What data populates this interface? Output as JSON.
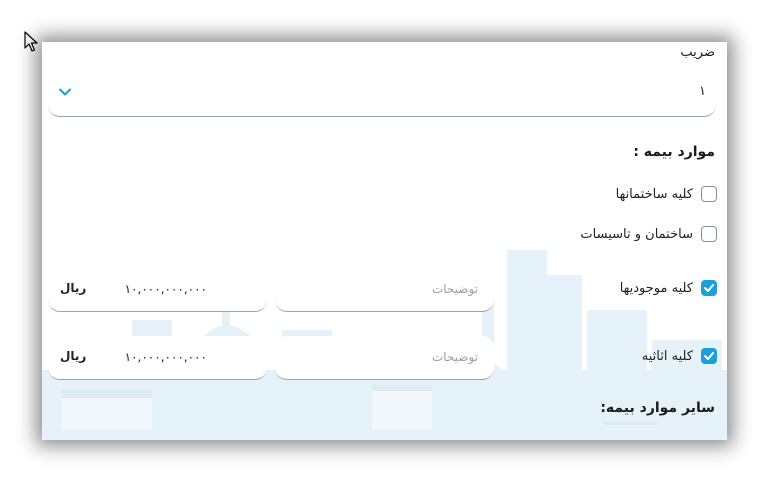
{
  "form": {
    "coefficient_label": "ضریب",
    "coefficient_value": "۱",
    "insurance_items_title": "موارد بیمه :",
    "other_items_title": "سایر موارد بیمه:"
  },
  "items": [
    {
      "label": "کلیه ساختمانها",
      "checked": false
    },
    {
      "label": "ساختمان و تاسیسات",
      "checked": false
    },
    {
      "label": "کلیه موجودیها",
      "checked": true,
      "description_placeholder": "توضیحات",
      "amount": "۱۰,۰۰۰,۰۰۰,۰۰۰",
      "unit": "ریال"
    },
    {
      "label": "کلیه اثاثیه",
      "checked": true,
      "description_placeholder": "توضیحات",
      "amount": "۱۰,۰۰۰,۰۰۰,۰۰۰",
      "unit": "ریال"
    }
  ],
  "icons": {
    "cursor": "arrow-cursor-icon",
    "chevron": "chevron-down-icon",
    "check": "checkmark-icon"
  },
  "colors": {
    "accent": "#1ca0dc",
    "skyline": "#e3f1f8"
  }
}
